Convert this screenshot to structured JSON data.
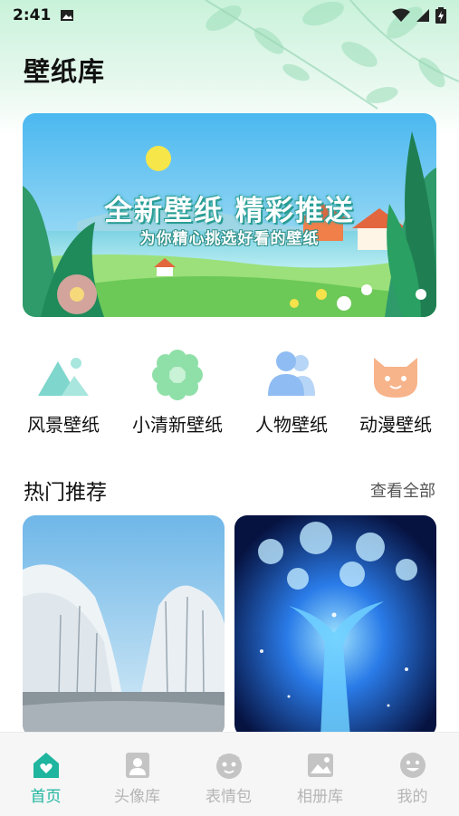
{
  "status_bar": {
    "time": "2:41"
  },
  "header": {
    "title": "壁纸库"
  },
  "banner": {
    "title": "全新壁纸 精彩推送",
    "subtitle": "为你精心挑选好看的壁纸"
  },
  "categories": [
    {
      "label": "风景壁纸",
      "icon": "mountain-icon",
      "color": "#7fd6cc"
    },
    {
      "label": "小清新壁纸",
      "icon": "flower-icon",
      "color": "#8fe0a8"
    },
    {
      "label": "人物壁纸",
      "icon": "people-icon",
      "color": "#8fbcf2"
    },
    {
      "label": "动漫壁纸",
      "icon": "cat-icon",
      "color": "#f7b38a"
    }
  ],
  "hot_section": {
    "title": "热门推荐",
    "view_all": "查看全部"
  },
  "thumbnails": [
    {
      "subject": "snowy-trees-lake"
    },
    {
      "subject": "glowing-blue-tree"
    }
  ],
  "bottom_nav": {
    "active_color": "#1fb59f",
    "inactive_color": "#c4c4c4",
    "items": [
      {
        "label": "首页",
        "icon": "home-icon",
        "active": true
      },
      {
        "label": "头像库",
        "icon": "avatar-icon",
        "active": false
      },
      {
        "label": "表情包",
        "icon": "emoji-pack-icon",
        "active": false
      },
      {
        "label": "相册库",
        "icon": "album-icon",
        "active": false
      },
      {
        "label": "我的",
        "icon": "smiley-icon",
        "active": false
      }
    ]
  }
}
